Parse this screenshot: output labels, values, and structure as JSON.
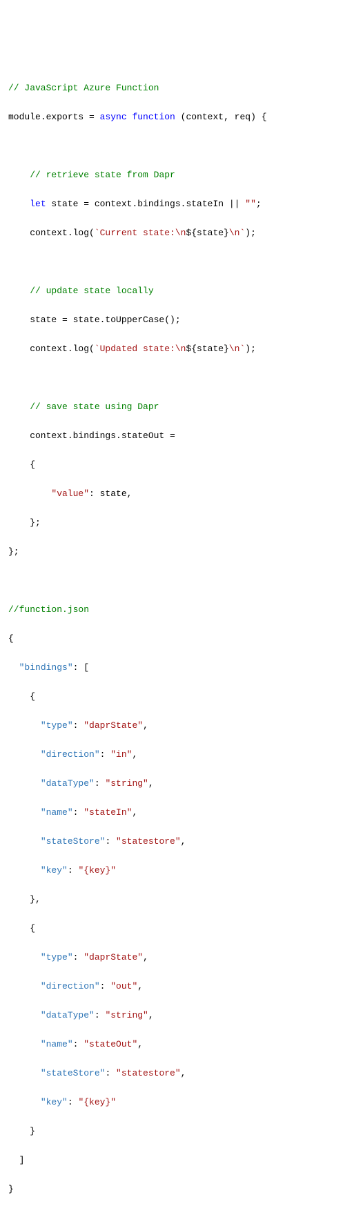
{
  "code": {
    "c1": "// JavaScript Azure Function",
    "l2_a": "module",
    "l2_b": ".exports = ",
    "l2_c": "async function",
    "l2_d": " (",
    "l2_e": "context, req",
    "l2_f": ") {",
    "c2": "// retrieve state from Dapr",
    "l4_a": "let",
    "l4_b": " state = context.bindings.stateIn || ",
    "l4_c": "\"\"",
    "l4_d": ";",
    "l5_a": "    context.log(",
    "l5_b": "`Current state:\\n",
    "l5_c": "${state}",
    "l5_d": "\\n`",
    "l5_e": ");",
    "c3": "// update state locally",
    "l7_a": "    state = state.toUpperCase();",
    "l8_a": "    context.log(",
    "l8_b": "`Updated state:\\n",
    "l8_c": "${state}",
    "l8_d": "\\n`",
    "l8_e": ");",
    "c4": "// save state using Dapr",
    "l10_a": "    context.bindings.stateOut =",
    "l11_a": "    {",
    "l12_a": "\"value\"",
    "l12_b": ": state,",
    "l13_a": "    };",
    "l14_a": "};",
    "c5": "//function.json",
    "j1": "{",
    "j2_a": "\"bindings\"",
    "j2_b": ": [",
    "j3": "    {",
    "j4_a": "\"type\"",
    "j4_b": ": ",
    "j4_c": "\"daprState\"",
    "j4_d": ",",
    "j5_a": "\"direction\"",
    "j5_c": "\"in\"",
    "j6_a": "\"dataType\"",
    "j6_c": "\"string\"",
    "j7_a": "\"name\"",
    "j7_c": "\"stateIn\"",
    "j8_a": "\"stateStore\"",
    "j8_c": "\"statestore\"",
    "j9_a": "\"key\"",
    "j9_c": "\"{key}\"",
    "j10": "    },",
    "j11": "    {",
    "j12_c": "\"daprState\"",
    "j13_c": "\"out\"",
    "j14_c": "\"string\"",
    "j15_c": "\"stateOut\"",
    "j16_c": "\"statestore\"",
    "j17_c": "\"{key}\"",
    "j18": "    }",
    "j19": "  ]",
    "j20": "}"
  }
}
